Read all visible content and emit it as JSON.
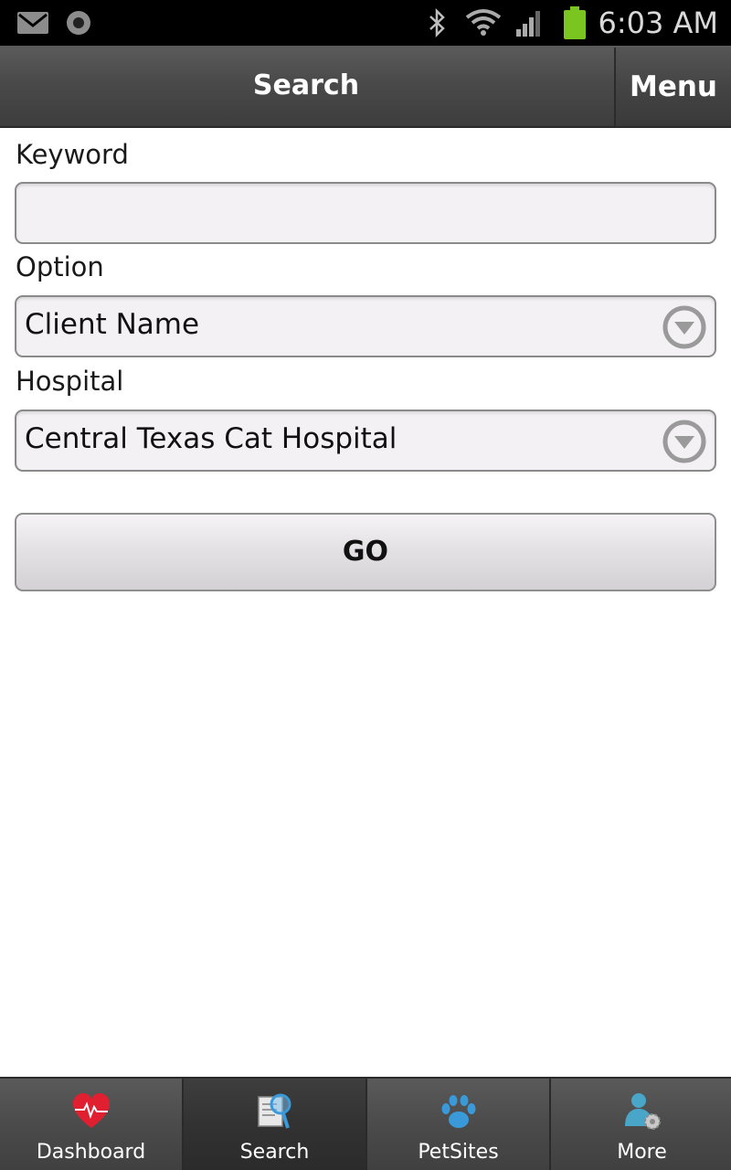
{
  "status_bar": {
    "time": "6:03 AM",
    "icons": [
      "gmail-icon",
      "record-icon",
      "bluetooth-icon",
      "wifi-icon",
      "signal-icon",
      "battery-icon"
    ]
  },
  "header": {
    "title": "Search",
    "menu_label": "Menu"
  },
  "form": {
    "keyword_label": "Keyword",
    "keyword_value": "",
    "option_label": "Option",
    "option_value": "Client Name",
    "hospital_label": "Hospital",
    "hospital_value": "Central Texas Cat Hospital",
    "go_label": "GO"
  },
  "tabs": [
    {
      "label": "Dashboard",
      "icon": "heart-pulse-icon"
    },
    {
      "label": "Search",
      "icon": "search-document-icon",
      "active": true
    },
    {
      "label": "PetSites",
      "icon": "paw-icon"
    },
    {
      "label": "More",
      "icon": "user-settings-icon"
    }
  ],
  "colors": {
    "tab_icon_blue": "#3a9ad9",
    "heart_red": "#e02030",
    "battery_green": "#7ac51f"
  }
}
